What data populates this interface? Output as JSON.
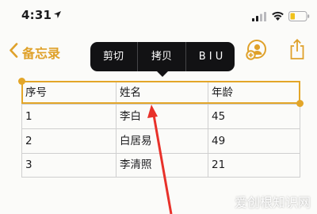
{
  "status_bar": {
    "time": "4:31"
  },
  "navbar": {
    "back_label": "备忘录"
  },
  "callout_menu": {
    "cut": "剪切",
    "copy": "拷贝",
    "format": "B I U"
  },
  "table": {
    "headers": [
      "序号",
      "姓名",
      "年龄"
    ],
    "rows": [
      [
        "1",
        "李白",
        "45"
      ],
      [
        "2",
        "白居易",
        "49"
      ],
      [
        "3",
        "李清照",
        "21"
      ]
    ]
  },
  "watermark": "爱创根知识网",
  "colors": {
    "accent": "#dfa12a",
    "arrow": "#e8312a"
  }
}
